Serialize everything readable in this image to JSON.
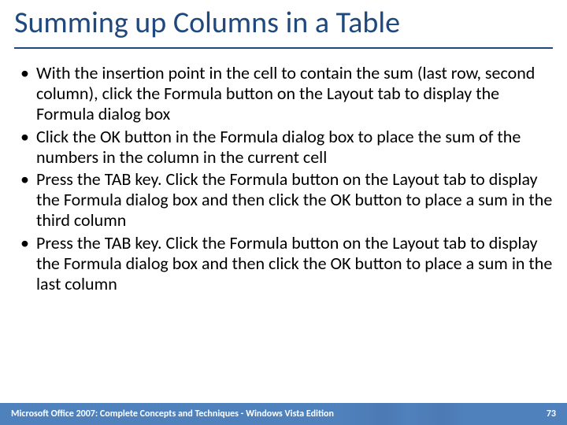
{
  "title": "Summing up Columns in a Table",
  "bullets": [
    "With the insertion point in the cell to contain the sum (last row, second column), click the Formula button on the Layout tab to display the Formula dialog box",
    "Click the OK button in the Formula dialog box to place the sum of the numbers in the column in the current cell",
    "Press the TAB key. Click the Formula button on the Layout tab to display the Formula dialog box and then click the OK button to place a sum in the third column",
    "Press the TAB key. Click the Formula button on the Layout tab to display the Formula dialog box and then click the OK button to place a sum in the last column"
  ],
  "footer": {
    "text": "Microsoft Office 2007: Complete Concepts and Techniques - Windows Vista Edition",
    "page": "73"
  }
}
